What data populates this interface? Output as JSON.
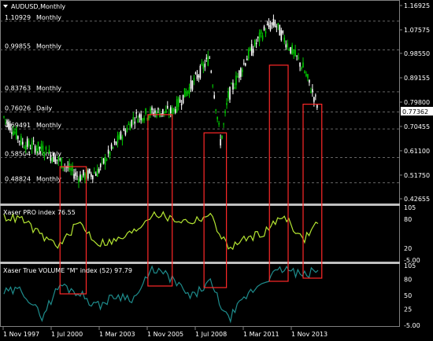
{
  "chart_title": "AUDUSD,Monthly",
  "current_price": "0.77362",
  "price_axis": [
    "1.16925",
    "1.07575",
    "0.98550",
    "0.89155",
    "0.79800",
    "0.70455",
    "0.61100",
    "0.51750",
    "0.42655"
  ],
  "levels": [
    {
      "price": "1.10929",
      "tf": "Monthly"
    },
    {
      "price": "0.99855",
      "tf": "Monthly"
    },
    {
      "price": "0.83763",
      "tf": "Monthly"
    },
    {
      "price": "0.76026",
      "tf": "Daily"
    },
    {
      "price": "0.69491",
      "tf": "Monthly"
    },
    {
      "price": "0.58504",
      "tf": "Monthly"
    },
    {
      "price": "0.48824",
      "tf": "Monthly"
    }
  ],
  "pro_index": {
    "label": "Xaser PRO index 76.55",
    "axis": [
      "105",
      "80",
      "20",
      "-5.00"
    ]
  },
  "volume_index": {
    "label": "Xaser True VOLUME \"M\" index (52) 97.79",
    "axis": [
      "105",
      "80",
      "50",
      "25",
      "-5.00"
    ]
  },
  "time_axis": [
    "1 Nov 1997",
    "1 Jul 2000",
    "1 Mar 2003",
    "1 Nov 2005",
    "1 Jul 2008",
    "1 Mar 2011",
    "1 Nov 2013"
  ],
  "colors": {
    "bull": "#00c800",
    "bear": "#ffffff",
    "pro_line": "#b4e632",
    "vol_line": "#1e8c8c",
    "highlight": "#ff2828",
    "separator": "#c0c0c0",
    "grid": "#646464"
  },
  "chart_data": [
    {
      "type": "line",
      "title": "AUDUSD,Monthly",
      "ylim": [
        0.42655,
        1.16925
      ],
      "x": [
        1997,
        1998,
        1999,
        2000,
        2001,
        2002,
        2003,
        2004,
        2005,
        2006,
        2007,
        2008,
        2008.6,
        2009,
        2010,
        2011,
        2011.5,
        2012,
        2013,
        2013.8
      ],
      "series": [
        {
          "values": [
            0.74,
            0.64,
            0.62,
            0.57,
            0.51,
            0.53,
            0.64,
            0.74,
            0.76,
            0.76,
            0.86,
            0.97,
            0.64,
            0.82,
            0.97,
            1.08,
            1.1,
            1.04,
            0.93,
            0.78
          ]
        }
      ]
    },
    {
      "type": "line",
      "title": "Xaser PRO index 76.55",
      "ylim": [
        -5,
        105
      ],
      "x": [
        1997,
        1998,
        1999,
        2000,
        2001,
        2002,
        2003,
        2004,
        2005,
        2006,
        2007,
        2008,
        2009,
        2010,
        2011,
        2012,
        2013,
        2013.8
      ],
      "series": [
        {
          "values": [
            85,
            80,
            45,
            25,
            75,
            30,
            35,
            55,
            95,
            80,
            75,
            90,
            20,
            40,
            55,
            90,
            35,
            76.55
          ]
        }
      ]
    },
    {
      "type": "line",
      "title": "Xaser True VOLUME \"M\" index (52) 97.79",
      "ylim": [
        -5,
        105
      ],
      "x": [
        1997,
        1998,
        1999,
        2000,
        2001,
        2002,
        2003,
        2004,
        2005,
        2006,
        2007,
        2008,
        2009,
        2010,
        2011,
        2012,
        2013,
        2013.8
      ],
      "series": [
        {
          "values": [
            55,
            60,
            10,
            70,
            55,
            30,
            50,
            45,
            100,
            80,
            45,
            75,
            5,
            50,
            80,
            100,
            85,
            97.79
          ]
        }
      ]
    }
  ]
}
